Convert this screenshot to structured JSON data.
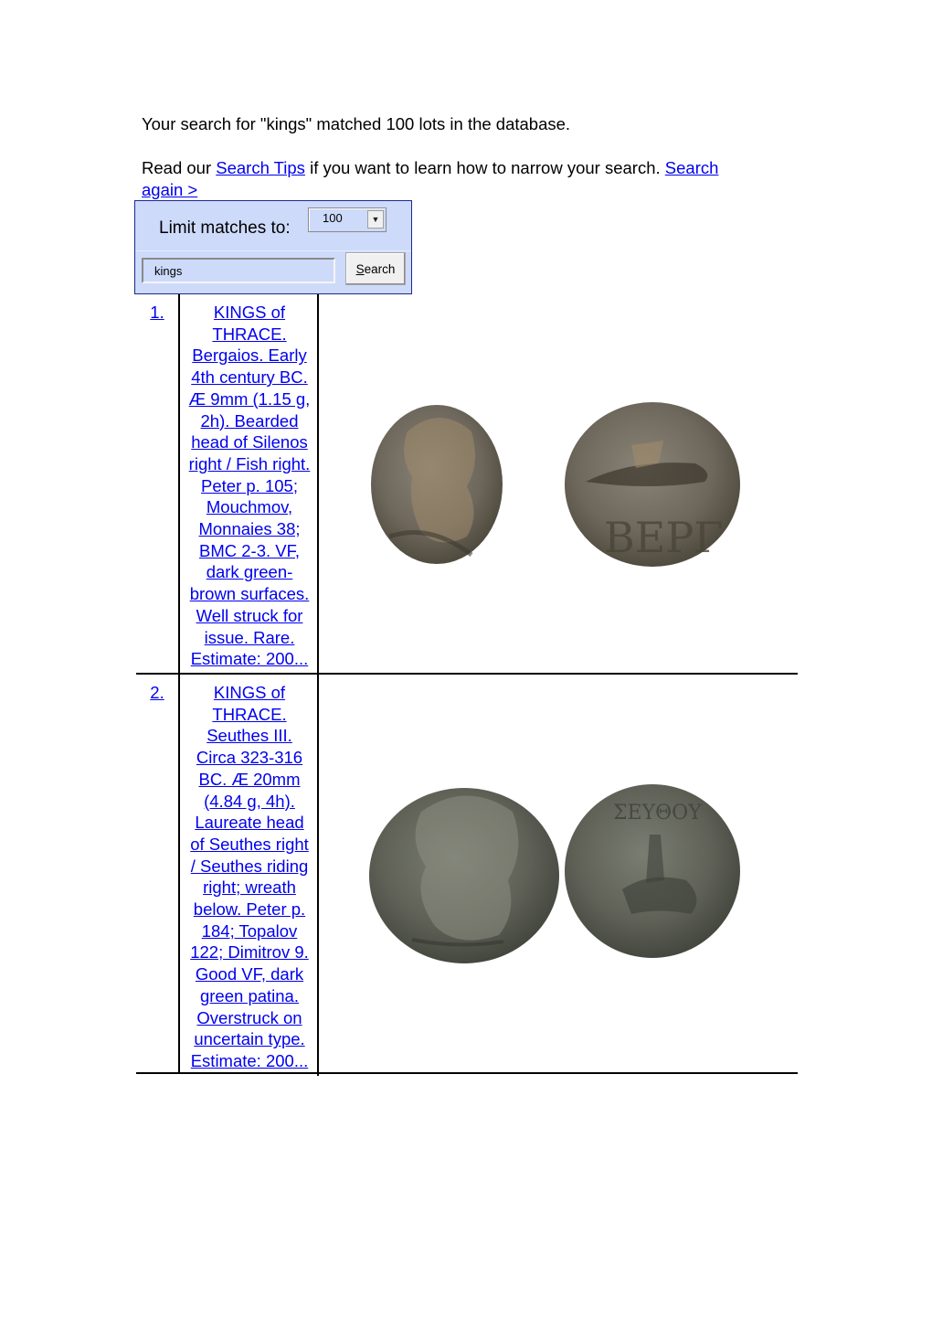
{
  "summary": {
    "text": "Your search for \"kings\" matched 100 lots in the database."
  },
  "tips": {
    "prefix": "Read our ",
    "search_tips_link": "Search Tips",
    "middle": " if you want to learn how to narrow your search. ",
    "search_again_link_part1": "Search ",
    "search_again_link_part2": "again > "
  },
  "search_panel": {
    "limit_label": "Limit matches to:",
    "limit_value": "100",
    "query_value": "kings",
    "search_button_accel": "S",
    "search_button_rest": "earch",
    "colors": {
      "panel_bg": "#cddafa",
      "panel_border": "#1b2a8c"
    }
  },
  "results": [
    {
      "number": "1.",
      "description_lines": [
        "KINGS of",
        "THRACE.",
        "Bergaios. Early",
        "4th century BC.",
        "Æ 9mm (1.15 g,",
        "2h). Bearded",
        "head of Silenos",
        "right / Fish right.",
        "Peter p. 105;",
        "Mouchmov,",
        "Monnaies 38;",
        "BMC 2-3. VF,",
        "dark green-",
        "brown surfaces.",
        "Well struck for",
        "issue. Rare.",
        "Estimate: 200..."
      ],
      "image": {
        "obverse_icon": "coin-obverse-silenos-head",
        "reverse_icon": "coin-reverse-fish-BEPΓ",
        "reverse_legend": "ΒΕΡΓ"
      }
    },
    {
      "number": "2.",
      "description_lines": [
        "KINGS of",
        "THRACE.",
        "Seuthes III.",
        "Circa 323-316",
        "BC. Æ 20mm",
        "(4.84 g, 4h).",
        "Laureate head",
        "of Seuthes right",
        "/ Seuthes riding",
        "right; wreath",
        "below. Peter p.",
        "184; Topalov",
        "122; Dimitrov 9.",
        "Good VF, dark",
        "green patina.",
        "Overstruck on",
        "uncertain type.",
        "Estimate: 200..."
      ],
      "image": {
        "obverse_icon": "coin-obverse-seuthes-head",
        "reverse_icon": "coin-reverse-horseman",
        "reverse_legend": "ΣΕΥΘΟΥ"
      }
    }
  ],
  "colors": {
    "link": "#0000ee",
    "text": "#000000"
  }
}
